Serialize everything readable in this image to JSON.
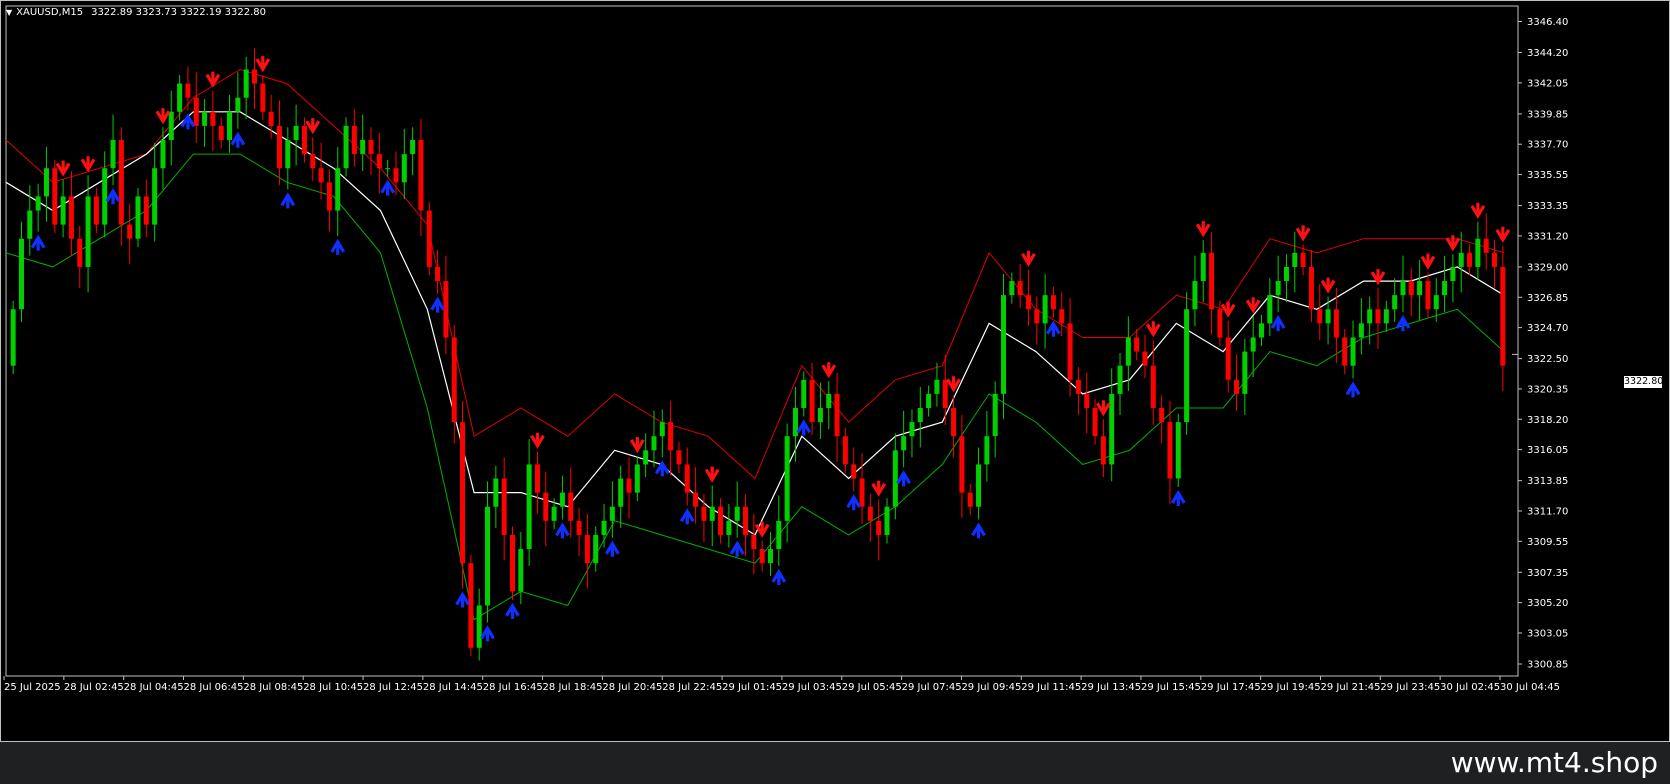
{
  "header": {
    "symbol": "XAUUSD,M15",
    "ohlc": "3322.89 3323.73 3322.19 3322.80",
    "menu_icon": "triangle-down-icon"
  },
  "current_price": "3322.80",
  "footer": {
    "watermark": "www.mt4.shop"
  },
  "colors": {
    "background": "#000000",
    "bull": "#00d000",
    "bear": "#ff0000",
    "upper_band": "#e00000",
    "lower_band": "#00b000",
    "middle_line": "#ffffff",
    "sell_arrow": "#ff1010",
    "buy_arrow": "#1030ff"
  },
  "chart_data": {
    "type": "candlestick",
    "ylim": [
      3300.0,
      3347.5
    ],
    "y_ticks": [
      "3346.40",
      "3344.20",
      "3342.05",
      "3339.85",
      "3337.70",
      "3335.55",
      "3333.35",
      "3331.20",
      "3329.00",
      "3326.85",
      "3324.70",
      "3322.50",
      "3320.35",
      "3318.20",
      "3316.05",
      "3313.85",
      "3311.70",
      "3309.55",
      "3307.35",
      "3305.20",
      "3303.05",
      "3300.85"
    ],
    "x_ticks": [
      "25 Jul 2025",
      "28 Jul 02:45",
      "28 Jul 04:45",
      "28 Jul 06:45",
      "28 Jul 08:45",
      "28 Jul 10:45",
      "28 Jul 12:45",
      "28 Jul 14:45",
      "28 Jul 16:45",
      "28 Jul 18:45",
      "28 Jul 20:45",
      "28 Jul 22:45",
      "29 Jul 01:45",
      "29 Jul 03:45",
      "29 Jul 05:45",
      "29 Jul 07:45",
      "29 Jul 09:45",
      "29 Jul 11:45",
      "29 Jul 13:45",
      "29 Jul 15:45",
      "29 Jul 17:45",
      "29 Jul 19:45",
      "29 Jul 21:45",
      "29 Jul 23:45",
      "30 Jul 02:45",
      "30 Jul 04:45"
    ],
    "closes": [
      3326,
      3331,
      3333,
      3334,
      3336,
      3332,
      3334,
      3331,
      3329,
      3334,
      3332,
      3336,
      3338,
      3332,
      3331,
      3334,
      3332,
      3336,
      3338,
      3340,
      3342,
      3341,
      3339,
      3340,
      3339,
      3338,
      3340,
      3341,
      3343,
      3342,
      3340,
      3339,
      3336,
      3338,
      3339,
      3337,
      3336,
      3335,
      3333,
      3336,
      3339,
      3337,
      3338,
      3337,
      3336,
      3336,
      3335,
      3337,
      3338,
      3333,
      3329,
      3328,
      3324,
      3318,
      3308,
      3302,
      3305,
      3312,
      3314,
      3310,
      3306,
      3309,
      3315,
      3313,
      3311,
      3312,
      3313,
      3311,
      3310,
      3308,
      3310,
      3311,
      3312,
      3314,
      3313,
      3315,
      3316,
      3317,
      3318,
      3316,
      3315,
      3313,
      3312,
      3311,
      3312,
      3310,
      3311,
      3312,
      3310,
      3309,
      3308,
      3309,
      3311,
      3317,
      3319,
      3321,
      3318,
      3319,
      3320,
      3317,
      3315,
      3314,
      3312,
      3311,
      3310,
      3312,
      3316,
      3317,
      3318,
      3319,
      3320,
      3321,
      3319,
      3317,
      3313,
      3312,
      3315,
      3317,
      3320,
      3327,
      3328,
      3327,
      3326,
      3325,
      3327,
      3326,
      3325,
      3321,
      3320,
      3319,
      3317,
      3315,
      3320,
      3322,
      3324,
      3323,
      3322,
      3319,
      3318,
      3314,
      3318,
      3326,
      3328,
      3330,
      3326,
      3324,
      3321,
      3320,
      3323,
      3324,
      3325,
      3327,
      3328,
      3329,
      3330,
      3329,
      3326,
      3325,
      3326,
      3324,
      3322,
      3324,
      3325,
      3326,
      3325,
      3326,
      3327,
      3328,
      3327,
      3328,
      3326,
      3327,
      3328,
      3329,
      3330,
      3329,
      3331,
      3330,
      3329,
      3322
    ],
    "bands": {
      "upper": [
        3338,
        3335,
        3336,
        3337,
        3341,
        3343,
        3342,
        3339,
        3336,
        3332,
        3317,
        3319,
        3317,
        3320,
        3318,
        3317,
        3314,
        3322,
        3318,
        3321,
        3322,
        3330,
        3326,
        3324,
        3324,
        3327,
        3326,
        3331,
        3330,
        3331,
        3331,
        3331,
        3330
      ],
      "middle": [
        3335,
        3333,
        3335,
        3337,
        3340,
        3340,
        3338,
        3336,
        3333,
        3326,
        3313,
        3313,
        3312,
        3316,
        3315,
        3312,
        3310,
        3317,
        3314,
        3317,
        3318,
        3325,
        3323,
        3320,
        3321,
        3325,
        3323,
        3327,
        3326,
        3328,
        3328,
        3329,
        3327
      ],
      "lower": [
        3330,
        3329,
        3331,
        3333,
        3337,
        3337,
        3335,
        3334,
        3330,
        3319,
        3304,
        3306,
        3305,
        3311,
        3310,
        3309,
        3308,
        3312,
        3310,
        3312,
        3315,
        3320,
        3318,
        3315,
        3316,
        3319,
        3319,
        3323,
        3322,
        3324,
        3325,
        3326,
        3323
      ]
    },
    "sell_signals": [
      2,
      3,
      6,
      8,
      10,
      12,
      21,
      25,
      28,
      30,
      33,
      35,
      38,
      41,
      44,
      46,
      48,
      49,
      50,
      52,
      53,
      55,
      57,
      58,
      59,
      60
    ],
    "buy_signals": [
      1,
      4,
      7,
      9,
      11,
      13,
      15,
      17,
      18,
      19,
      20,
      22,
      24,
      26,
      27,
      29,
      31,
      32,
      34,
      36,
      39,
      42,
      47,
      51,
      54,
      56
    ]
  }
}
